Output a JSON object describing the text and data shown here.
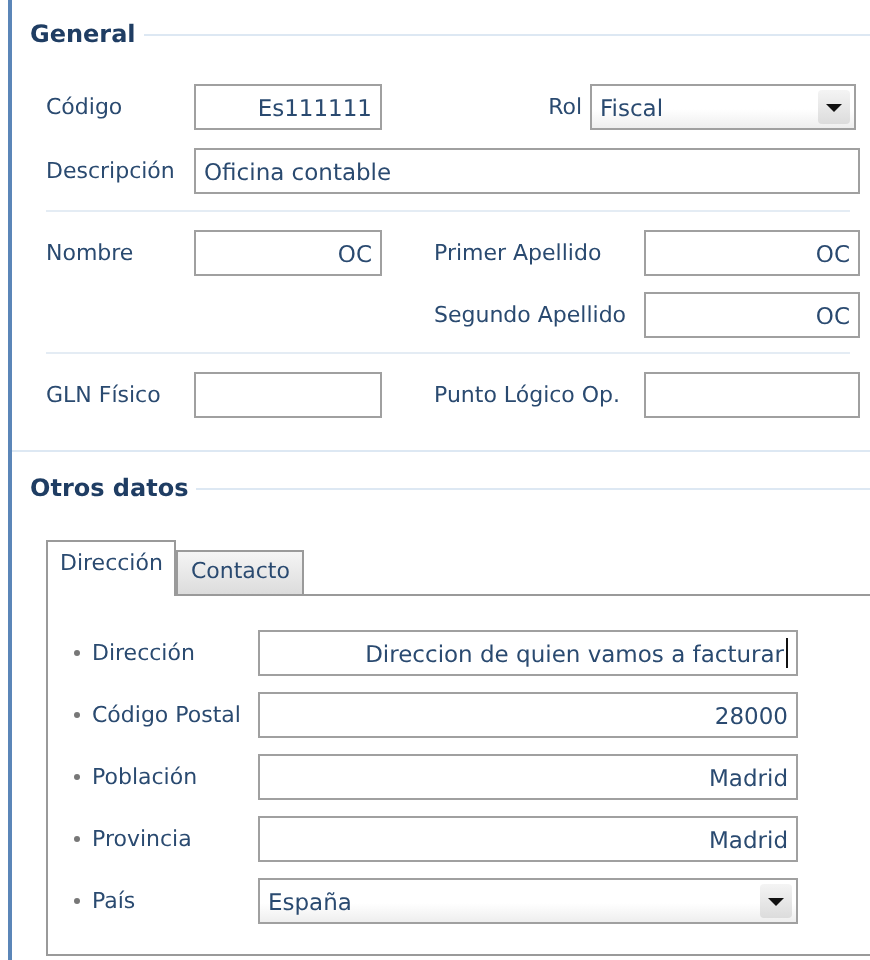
{
  "general": {
    "legend": "General",
    "codigo": {
      "label": "Código",
      "value": "Es111111"
    },
    "rol": {
      "label": "Rol",
      "value": "Fiscal"
    },
    "descripcion": {
      "label": "Descripción",
      "value": "Oficina contable"
    },
    "nombre": {
      "label": "Nombre",
      "value": "OC"
    },
    "primer_apellido": {
      "label": "Primer Apellido",
      "value": "OC"
    },
    "segundo_apellido": {
      "label": "Segundo Apellido",
      "value": "OC"
    },
    "gln_fisico": {
      "label": "GLN Físico"
    },
    "punto_logico": {
      "label": "Punto Lógico Op."
    }
  },
  "otros_datos": {
    "legend": "Otros datos",
    "tabs": [
      {
        "label": "Dirección",
        "selected": true
      },
      {
        "label": "Contacto",
        "selected": false
      }
    ],
    "fields": [
      {
        "kind": "text",
        "label": "Dirección",
        "required": true,
        "value": "Direccion de quien vamos a facturar",
        "focused": true
      },
      {
        "kind": "text",
        "label": "Código Postal",
        "required": true,
        "value": "28000",
        "focused": false
      },
      {
        "kind": "text",
        "label": "Población",
        "required": true,
        "value": "Madrid",
        "focused": false
      },
      {
        "kind": "text",
        "label": "Provincia",
        "required": true,
        "value": "Madrid",
        "focused": false
      },
      {
        "kind": "select",
        "label": "País",
        "required": true,
        "value": "España"
      }
    ]
  }
}
